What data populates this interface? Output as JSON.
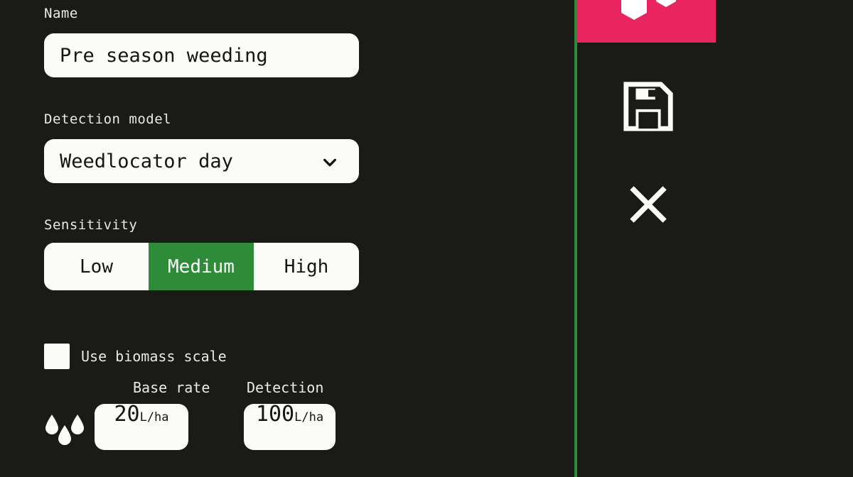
{
  "theme": {
    "background": "#1a1a17",
    "surface": "#fbfbfa",
    "text_on_surface": "#16160f",
    "text_on_background": "#e9e9e6",
    "accent_green": "#2e8b38",
    "accent_pink": "#e8255f"
  },
  "form": {
    "name": {
      "label": "Name",
      "value": "Pre season weeding",
      "placeholder": "Name"
    },
    "detection_model": {
      "label": "Detection model",
      "value": "Weedlocator day",
      "chevron_icon": "chevron-down-icon"
    },
    "sensitivity": {
      "label": "Sensitivity",
      "options": [
        "Low",
        "Medium",
        "High"
      ],
      "selected": "Medium"
    },
    "biomass": {
      "label": "Use biomass scale",
      "checked": false
    },
    "rates": {
      "icon": "water-droplets-icon",
      "base_rate": {
        "label": "Base rate",
        "value": "20",
        "unit": "L/ha"
      },
      "detection": {
        "label": "Detection",
        "value": "100",
        "unit": "L/ha"
      }
    }
  },
  "actions": {
    "delete": {
      "icon": "hexagons-icon",
      "label": ""
    },
    "save": {
      "icon": "floppy-disk-save-icon",
      "label": ""
    },
    "close": {
      "icon": "close-x-icon",
      "label": ""
    }
  }
}
